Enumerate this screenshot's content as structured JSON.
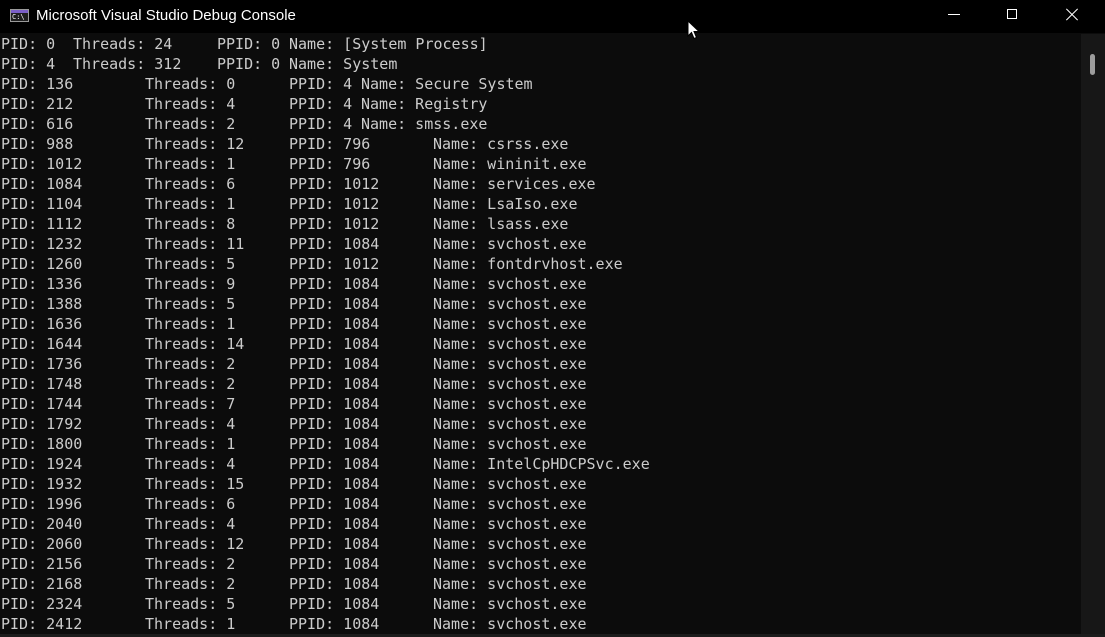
{
  "window": {
    "title": "Microsoft Visual Studio Debug Console",
    "icon_text": "C:\\"
  },
  "console": {
    "lines": [
      {
        "pid": "PID: 0",
        "threads": "Threads: 24",
        "ppid": "PPID: 0",
        "name": "Name: [System Process]",
        "layout": "A"
      },
      {
        "pid": "PID: 4",
        "threads": "Threads: 312",
        "ppid": "PPID: 0",
        "name": "Name: System",
        "layout": "A"
      },
      {
        "pid": "PID: 136",
        "threads": "Threads: 0",
        "ppid": "PPID: 4",
        "name": "Name: Secure System",
        "layout": "B"
      },
      {
        "pid": "PID: 212",
        "threads": "Threads: 4",
        "ppid": "PPID: 4",
        "name": "Name: Registry",
        "layout": "B"
      },
      {
        "pid": "PID: 616",
        "threads": "Threads: 2",
        "ppid": "PPID: 4",
        "name": "Name: smss.exe",
        "layout": "B"
      },
      {
        "pid": "PID: 988",
        "threads": "Threads: 12",
        "ppid": "PPID: 796",
        "name": "Name: csrss.exe",
        "layout": "C"
      },
      {
        "pid": "PID: 1012",
        "threads": "Threads: 1",
        "ppid": "PPID: 796",
        "name": "Name: wininit.exe",
        "layout": "C"
      },
      {
        "pid": "PID: 1084",
        "threads": "Threads: 6",
        "ppid": "PPID: 1012",
        "name": "Name: services.exe",
        "layout": "C"
      },
      {
        "pid": "PID: 1104",
        "threads": "Threads: 1",
        "ppid": "PPID: 1012",
        "name": "Name: LsaIso.exe",
        "layout": "C"
      },
      {
        "pid": "PID: 1112",
        "threads": "Threads: 8",
        "ppid": "PPID: 1012",
        "name": "Name: lsass.exe",
        "layout": "C"
      },
      {
        "pid": "PID: 1232",
        "threads": "Threads: 11",
        "ppid": "PPID: 1084",
        "name": "Name: svchost.exe",
        "layout": "C"
      },
      {
        "pid": "PID: 1260",
        "threads": "Threads: 5",
        "ppid": "PPID: 1012",
        "name": "Name: fontdrvhost.exe",
        "layout": "C"
      },
      {
        "pid": "PID: 1336",
        "threads": "Threads: 9",
        "ppid": "PPID: 1084",
        "name": "Name: svchost.exe",
        "layout": "C"
      },
      {
        "pid": "PID: 1388",
        "threads": "Threads: 5",
        "ppid": "PPID: 1084",
        "name": "Name: svchost.exe",
        "layout": "C"
      },
      {
        "pid": "PID: 1636",
        "threads": "Threads: 1",
        "ppid": "PPID: 1084",
        "name": "Name: svchost.exe",
        "layout": "C"
      },
      {
        "pid": "PID: 1644",
        "threads": "Threads: 14",
        "ppid": "PPID: 1084",
        "name": "Name: svchost.exe",
        "layout": "C"
      },
      {
        "pid": "PID: 1736",
        "threads": "Threads: 2",
        "ppid": "PPID: 1084",
        "name": "Name: svchost.exe",
        "layout": "C"
      },
      {
        "pid": "PID: 1748",
        "threads": "Threads: 2",
        "ppid": "PPID: 1084",
        "name": "Name: svchost.exe",
        "layout": "C"
      },
      {
        "pid": "PID: 1744",
        "threads": "Threads: 7",
        "ppid": "PPID: 1084",
        "name": "Name: svchost.exe",
        "layout": "C"
      },
      {
        "pid": "PID: 1792",
        "threads": "Threads: 4",
        "ppid": "PPID: 1084",
        "name": "Name: svchost.exe",
        "layout": "C"
      },
      {
        "pid": "PID: 1800",
        "threads": "Threads: 1",
        "ppid": "PPID: 1084",
        "name": "Name: svchost.exe",
        "layout": "C"
      },
      {
        "pid": "PID: 1924",
        "threads": "Threads: 4",
        "ppid": "PPID: 1084",
        "name": "Name: IntelCpHDCPSvc.exe",
        "layout": "C"
      },
      {
        "pid": "PID: 1932",
        "threads": "Threads: 15",
        "ppid": "PPID: 1084",
        "name": "Name: svchost.exe",
        "layout": "C"
      },
      {
        "pid": "PID: 1996",
        "threads": "Threads: 6",
        "ppid": "PPID: 1084",
        "name": "Name: svchost.exe",
        "layout": "C"
      },
      {
        "pid": "PID: 2040",
        "threads": "Threads: 4",
        "ppid": "PPID: 1084",
        "name": "Name: svchost.exe",
        "layout": "C"
      },
      {
        "pid": "PID: 2060",
        "threads": "Threads: 12",
        "ppid": "PPID: 1084",
        "name": "Name: svchost.exe",
        "layout": "C"
      },
      {
        "pid": "PID: 2156",
        "threads": "Threads: 2",
        "ppid": "PPID: 1084",
        "name": "Name: svchost.exe",
        "layout": "C"
      },
      {
        "pid": "PID: 2168",
        "threads": "Threads: 2",
        "ppid": "PPID: 1084",
        "name": "Name: svchost.exe",
        "layout": "C"
      },
      {
        "pid": "PID: 2324",
        "threads": "Threads: 5",
        "ppid": "PPID: 1084",
        "name": "Name: svchost.exe",
        "layout": "C"
      },
      {
        "pid": "PID: 2412",
        "threads": "Threads: 1",
        "ppid": "PPID: 1084",
        "name": "Name: svchost.exe",
        "layout": "C"
      }
    ]
  },
  "colors": {
    "console_background": "#0c0c0c",
    "console_text": "#cccccc",
    "titlebar_background": "#000000",
    "title_text": "#ffffff",
    "icon_accent": "#7b5fc7"
  },
  "icons": {
    "app": "console-app-icon",
    "minimize": "minimize-icon",
    "maximize": "maximize-icon",
    "close": "close-icon",
    "cursor": "mouse-pointer-icon"
  }
}
